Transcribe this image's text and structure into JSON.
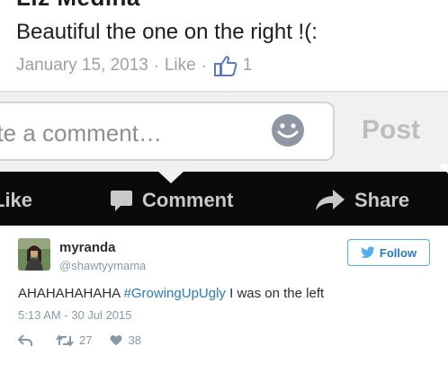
{
  "facebook": {
    "commenter_name": "Liz Medina",
    "comment_text": "Beautiful the one on the right !(:",
    "date": "January 15, 2013",
    "separator": "·",
    "like_link": "Like",
    "like_count": "1",
    "input_placeholder": "rite a comment…",
    "post_button": "Post",
    "actions": {
      "like": "Like",
      "comment": "Comment",
      "share": "Share"
    }
  },
  "tweet": {
    "display_name": "myranda",
    "handle": "@shawtyymama",
    "follow_label": "Follow",
    "text_before": "AHAHAHAHAHA ",
    "hashtag": "#GrowingUpUgly",
    "text_after": " I was on the left",
    "timestamp": "5:13 AM - 30 Jul 2015",
    "retweets": "27",
    "likes": "38"
  },
  "colors": {
    "facebook_blue": "#3b5998",
    "twitter_blue": "#55acee",
    "link_blue": "#2b7bb9"
  }
}
